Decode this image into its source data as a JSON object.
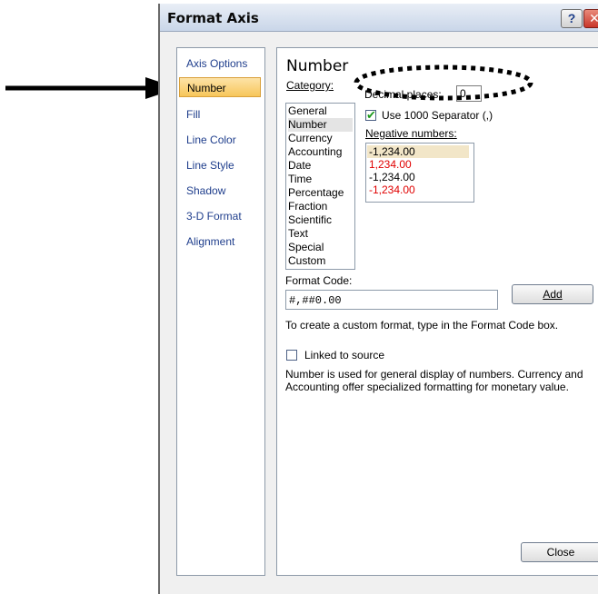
{
  "dialog": {
    "title": "Format Axis",
    "help_label": "?",
    "close_icon_glyph": "✕",
    "nav": [
      {
        "label": "Axis Options",
        "selected": false
      },
      {
        "label": "Number",
        "selected": true
      },
      {
        "label": "Fill",
        "selected": false
      },
      {
        "label": "Line Color",
        "selected": false
      },
      {
        "label": "Line Style",
        "selected": false
      },
      {
        "label": "Shadow",
        "selected": false
      },
      {
        "label": "3-D Format",
        "selected": false
      },
      {
        "label": "Alignment",
        "selected": false
      }
    ],
    "panel": {
      "title": "Number",
      "category_label": "Category:",
      "categories": [
        "General",
        "Number",
        "Currency",
        "Accounting",
        "Date",
        "Time",
        "Percentage",
        "Fraction",
        "Scientific",
        "Text",
        "Special",
        "Custom"
      ],
      "selected_category": "Number",
      "decimal_places_label": "Decimal places:",
      "decimal_places_value": "0",
      "use_separator_label": "Use 1000 Separator (,)",
      "use_separator_checked": true,
      "negative_numbers_label": "Negative numbers:",
      "negative_numbers": [
        {
          "text": "-1,234.00",
          "color": "#000000",
          "selected": true
        },
        {
          "text": "1,234.00",
          "color": "#e00000",
          "selected": false
        },
        {
          "text": "-1,234.00",
          "color": "#000000",
          "selected": false
        },
        {
          "text": "-1,234.00",
          "color": "#e00000",
          "selected": false
        }
      ],
      "format_code_label": "Format Code:",
      "format_code_value": "#,##0.00",
      "add_button": "Add",
      "custom_hint": "To create a custom format, type in the Format Code box.",
      "linked_label": "Linked to source",
      "linked_checked": false,
      "description": "Number is used for general display of numbers. Currency and Accounting offer specialized formatting for monetary value."
    },
    "close_button": "Close"
  },
  "colors": {
    "nav_link": "#1f3e8c",
    "selected_nav": "#f7c65a",
    "negative_red": "#e00000",
    "check_green": "#1e9a1e"
  }
}
